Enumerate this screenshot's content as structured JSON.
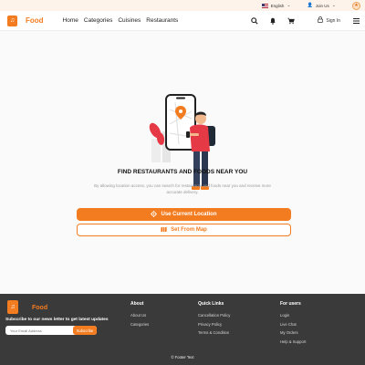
{
  "topbar": {
    "language": "English",
    "join": "Join Us",
    "icons": [
      "us-flag-icon",
      "chevron-down-icon",
      "user-icon",
      "coin-icon"
    ]
  },
  "nav": {
    "brand": "Food",
    "links": [
      "Home",
      "Categories",
      "Cuisines",
      "Restaurants"
    ],
    "signin": "Sign In",
    "icons": [
      "search-icon",
      "bell-icon",
      "cart-icon",
      "lock-icon",
      "menu-icon"
    ]
  },
  "main": {
    "title": "FIND RESTAURANTS AND FOODS NEAR YOU",
    "description": "By allowing location access, you can search for restaurants and foods near you and receive more accurate delivery.",
    "primary_button": "Use Current Location",
    "secondary_button": "Set From Map"
  },
  "footer": {
    "brand": "Food",
    "subscribe_text": "Subscribe to our news letter to get latest updates",
    "email_placeholder": "Your Email Address",
    "subscribe_button": "Subscribe",
    "columns": [
      {
        "heading": "About",
        "links": [
          "About Us",
          "Categories"
        ]
      },
      {
        "heading": "Quick Links",
        "links": [
          "Cancellation Policy",
          "Privacy Policy",
          "Terms & Condition"
        ]
      },
      {
        "heading": "For users",
        "links": [
          "Login",
          "Live Chat",
          "My Orders",
          "Help & Support"
        ]
      }
    ],
    "copyright": "© Footer Text"
  },
  "colors": {
    "accent": "#f47c20",
    "footer_bg": "#3a3a3a",
    "topbar_bg": "#fdf3ea"
  }
}
